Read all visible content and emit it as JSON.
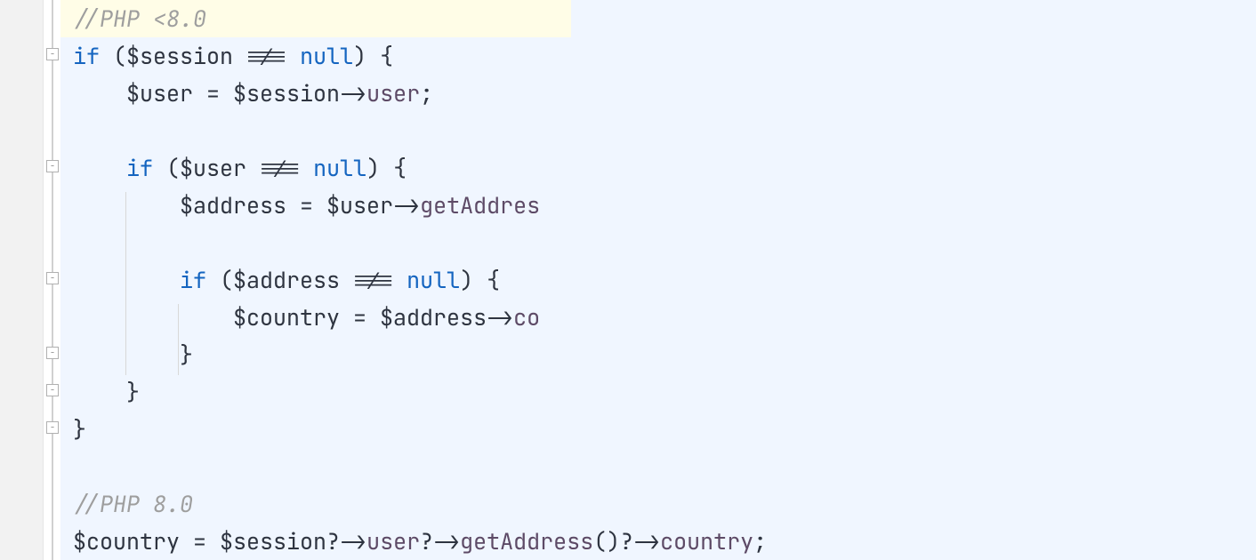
{
  "code": {
    "lines": [
      {
        "tokens": [
          {
            "cls": "comment",
            "text": "//PHP <8.0"
          }
        ],
        "highlighted": true,
        "highlightWidth": 574
      },
      {
        "tokens": [
          {
            "cls": "keyword",
            "text": "if"
          },
          {
            "cls": "paren",
            "text": " ("
          },
          {
            "cls": "variable",
            "text": "$session"
          },
          {
            "cls": "operator",
            "text": " !== "
          },
          {
            "cls": "null",
            "text": "null"
          },
          {
            "cls": "paren",
            "text": ") "
          },
          {
            "cls": "brace",
            "text": "{"
          }
        ],
        "foldMarker": "open"
      },
      {
        "tokens": [
          {
            "cls": "variable",
            "text": "    $user"
          },
          {
            "cls": "operator",
            "text": " = "
          },
          {
            "cls": "variable",
            "text": "$session"
          },
          {
            "cls": "arrow",
            "text": "->"
          },
          {
            "cls": "property",
            "text": "user"
          },
          {
            "cls": "semi",
            "text": ";"
          }
        ]
      },
      {
        "tokens": []
      },
      {
        "tokens": [
          {
            "cls": "plain",
            "text": "    "
          },
          {
            "cls": "keyword",
            "text": "if"
          },
          {
            "cls": "paren",
            "text": " ("
          },
          {
            "cls": "variable",
            "text": "$user"
          },
          {
            "cls": "operator",
            "text": " !== "
          },
          {
            "cls": "null",
            "text": "null"
          },
          {
            "cls": "paren",
            "text": ") "
          },
          {
            "cls": "brace",
            "text": "{"
          }
        ],
        "foldMarker": "open"
      },
      {
        "tokens": [
          {
            "cls": "variable",
            "text": "        $address"
          },
          {
            "cls": "operator",
            "text": " = "
          },
          {
            "cls": "variable",
            "text": "$user"
          },
          {
            "cls": "arrow",
            "text": "->"
          },
          {
            "cls": "method",
            "text": "getAddres"
          }
        ]
      },
      {
        "tokens": []
      },
      {
        "tokens": [
          {
            "cls": "plain",
            "text": "        "
          },
          {
            "cls": "keyword",
            "text": "if"
          },
          {
            "cls": "paren",
            "text": " ("
          },
          {
            "cls": "variable",
            "text": "$address"
          },
          {
            "cls": "operator",
            "text": " !== "
          },
          {
            "cls": "null",
            "text": "null"
          },
          {
            "cls": "paren",
            "text": ") "
          },
          {
            "cls": "brace",
            "text": "{"
          }
        ],
        "foldMarker": "open"
      },
      {
        "tokens": [
          {
            "cls": "variable",
            "text": "            $country"
          },
          {
            "cls": "operator",
            "text": " = "
          },
          {
            "cls": "variable",
            "text": "$address"
          },
          {
            "cls": "arrow",
            "text": "->"
          },
          {
            "cls": "property",
            "text": "co"
          }
        ]
      },
      {
        "tokens": [
          {
            "cls": "brace",
            "text": "        }"
          }
        ],
        "foldMarker": "close"
      },
      {
        "tokens": [
          {
            "cls": "brace",
            "text": "    }"
          }
        ],
        "foldMarker": "close"
      },
      {
        "tokens": [
          {
            "cls": "brace",
            "text": "}"
          }
        ],
        "foldMarker": "close"
      },
      {
        "tokens": []
      },
      {
        "tokens": [
          {
            "cls": "comment",
            "text": "//PHP 8.0"
          }
        ]
      },
      {
        "tokens": [
          {
            "cls": "variable",
            "text": "$country"
          },
          {
            "cls": "operator",
            "text": " = "
          },
          {
            "cls": "variable",
            "text": "$session"
          },
          {
            "cls": "nullsafe",
            "text": "?->"
          },
          {
            "cls": "property",
            "text": "user"
          },
          {
            "cls": "nullsafe",
            "text": "?->"
          },
          {
            "cls": "method",
            "text": "getAddress"
          },
          {
            "cls": "paren",
            "text": "()"
          },
          {
            "cls": "nullsafe",
            "text": "?->"
          },
          {
            "cls": "property",
            "text": "country"
          },
          {
            "cls": "semi",
            "text": ";"
          }
        ]
      }
    ]
  }
}
